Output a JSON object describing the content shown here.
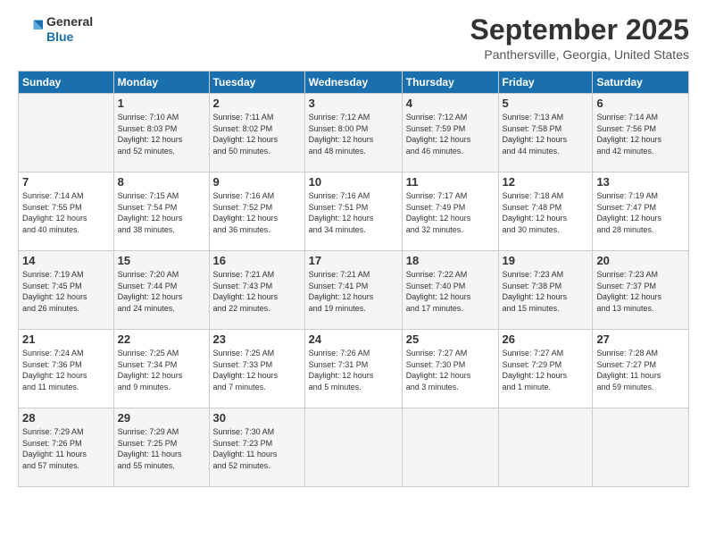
{
  "header": {
    "logo_general": "General",
    "logo_blue": "Blue",
    "month_title": "September 2025",
    "location": "Panthersville, Georgia, United States"
  },
  "days_of_week": [
    "Sunday",
    "Monday",
    "Tuesday",
    "Wednesday",
    "Thursday",
    "Friday",
    "Saturday"
  ],
  "weeks": [
    [
      {
        "day": "",
        "info": ""
      },
      {
        "day": "1",
        "info": "Sunrise: 7:10 AM\nSunset: 8:03 PM\nDaylight: 12 hours\nand 52 minutes."
      },
      {
        "day": "2",
        "info": "Sunrise: 7:11 AM\nSunset: 8:02 PM\nDaylight: 12 hours\nand 50 minutes."
      },
      {
        "day": "3",
        "info": "Sunrise: 7:12 AM\nSunset: 8:00 PM\nDaylight: 12 hours\nand 48 minutes."
      },
      {
        "day": "4",
        "info": "Sunrise: 7:12 AM\nSunset: 7:59 PM\nDaylight: 12 hours\nand 46 minutes."
      },
      {
        "day": "5",
        "info": "Sunrise: 7:13 AM\nSunset: 7:58 PM\nDaylight: 12 hours\nand 44 minutes."
      },
      {
        "day": "6",
        "info": "Sunrise: 7:14 AM\nSunset: 7:56 PM\nDaylight: 12 hours\nand 42 minutes."
      }
    ],
    [
      {
        "day": "7",
        "info": "Sunrise: 7:14 AM\nSunset: 7:55 PM\nDaylight: 12 hours\nand 40 minutes."
      },
      {
        "day": "8",
        "info": "Sunrise: 7:15 AM\nSunset: 7:54 PM\nDaylight: 12 hours\nand 38 minutes."
      },
      {
        "day": "9",
        "info": "Sunrise: 7:16 AM\nSunset: 7:52 PM\nDaylight: 12 hours\nand 36 minutes."
      },
      {
        "day": "10",
        "info": "Sunrise: 7:16 AM\nSunset: 7:51 PM\nDaylight: 12 hours\nand 34 minutes."
      },
      {
        "day": "11",
        "info": "Sunrise: 7:17 AM\nSunset: 7:49 PM\nDaylight: 12 hours\nand 32 minutes."
      },
      {
        "day": "12",
        "info": "Sunrise: 7:18 AM\nSunset: 7:48 PM\nDaylight: 12 hours\nand 30 minutes."
      },
      {
        "day": "13",
        "info": "Sunrise: 7:19 AM\nSunset: 7:47 PM\nDaylight: 12 hours\nand 28 minutes."
      }
    ],
    [
      {
        "day": "14",
        "info": "Sunrise: 7:19 AM\nSunset: 7:45 PM\nDaylight: 12 hours\nand 26 minutes."
      },
      {
        "day": "15",
        "info": "Sunrise: 7:20 AM\nSunset: 7:44 PM\nDaylight: 12 hours\nand 24 minutes."
      },
      {
        "day": "16",
        "info": "Sunrise: 7:21 AM\nSunset: 7:43 PM\nDaylight: 12 hours\nand 22 minutes."
      },
      {
        "day": "17",
        "info": "Sunrise: 7:21 AM\nSunset: 7:41 PM\nDaylight: 12 hours\nand 19 minutes."
      },
      {
        "day": "18",
        "info": "Sunrise: 7:22 AM\nSunset: 7:40 PM\nDaylight: 12 hours\nand 17 minutes."
      },
      {
        "day": "19",
        "info": "Sunrise: 7:23 AM\nSunset: 7:38 PM\nDaylight: 12 hours\nand 15 minutes."
      },
      {
        "day": "20",
        "info": "Sunrise: 7:23 AM\nSunset: 7:37 PM\nDaylight: 12 hours\nand 13 minutes."
      }
    ],
    [
      {
        "day": "21",
        "info": "Sunrise: 7:24 AM\nSunset: 7:36 PM\nDaylight: 12 hours\nand 11 minutes."
      },
      {
        "day": "22",
        "info": "Sunrise: 7:25 AM\nSunset: 7:34 PM\nDaylight: 12 hours\nand 9 minutes."
      },
      {
        "day": "23",
        "info": "Sunrise: 7:25 AM\nSunset: 7:33 PM\nDaylight: 12 hours\nand 7 minutes."
      },
      {
        "day": "24",
        "info": "Sunrise: 7:26 AM\nSunset: 7:31 PM\nDaylight: 12 hours\nand 5 minutes."
      },
      {
        "day": "25",
        "info": "Sunrise: 7:27 AM\nSunset: 7:30 PM\nDaylight: 12 hours\nand 3 minutes."
      },
      {
        "day": "26",
        "info": "Sunrise: 7:27 AM\nSunset: 7:29 PM\nDaylight: 12 hours\nand 1 minute."
      },
      {
        "day": "27",
        "info": "Sunrise: 7:28 AM\nSunset: 7:27 PM\nDaylight: 11 hours\nand 59 minutes."
      }
    ],
    [
      {
        "day": "28",
        "info": "Sunrise: 7:29 AM\nSunset: 7:26 PM\nDaylight: 11 hours\nand 57 minutes."
      },
      {
        "day": "29",
        "info": "Sunrise: 7:29 AM\nSunset: 7:25 PM\nDaylight: 11 hours\nand 55 minutes."
      },
      {
        "day": "30",
        "info": "Sunrise: 7:30 AM\nSunset: 7:23 PM\nDaylight: 11 hours\nand 52 minutes."
      },
      {
        "day": "",
        "info": ""
      },
      {
        "day": "",
        "info": ""
      },
      {
        "day": "",
        "info": ""
      },
      {
        "day": "",
        "info": ""
      }
    ]
  ]
}
